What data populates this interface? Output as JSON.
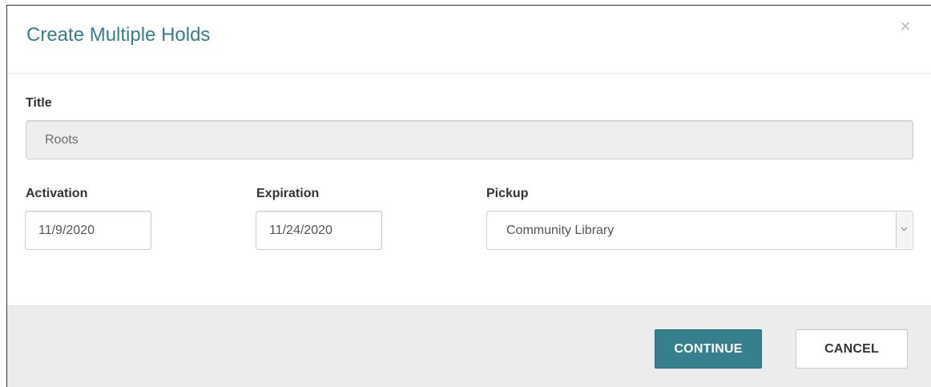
{
  "dialog": {
    "title": "Create Multiple Holds",
    "close_glyph": "×",
    "close_icon": "close-icon"
  },
  "form": {
    "title_label": "Title",
    "title_value": "Roots",
    "activation_label": "Activation",
    "activation_value": "11/9/2020",
    "expiration_label": "Expiration",
    "expiration_value": "11/24/2020",
    "pickup_label": "Pickup",
    "pickup_selected": "Community Library",
    "pickup_icon": "chevron-down-icon"
  },
  "footer": {
    "continue_label": "CONTINUE",
    "cancel_label": "CANCEL"
  },
  "colors": {
    "accent": "#35808c",
    "footer_bg": "#ececec",
    "readonly_bg": "#eeeeee"
  }
}
